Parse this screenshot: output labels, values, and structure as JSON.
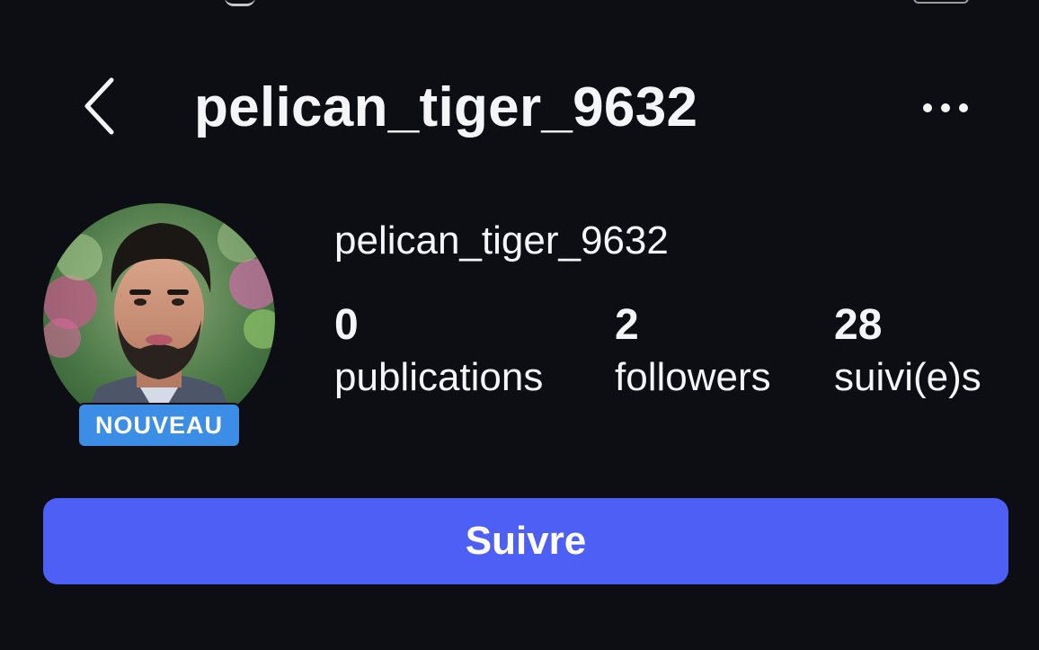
{
  "header": {
    "title": "pelican_tiger_9632",
    "back_icon": "chevron-left-icon",
    "more_icon": "ellipsis-horizontal-icon"
  },
  "profile": {
    "username": "pelican_tiger_9632",
    "badge": "NOUVEAU",
    "stats": [
      {
        "count": "0",
        "label": "publications"
      },
      {
        "count": "2",
        "label": "followers"
      },
      {
        "count": "28",
        "label": "suivi(e)s"
      }
    ]
  },
  "actions": {
    "follow_label": "Suivre"
  },
  "colors": {
    "background": "#0c0e13",
    "text": "#f5f5f7",
    "badge": "#3b8de6",
    "follow_button": "#4e5ff5"
  }
}
